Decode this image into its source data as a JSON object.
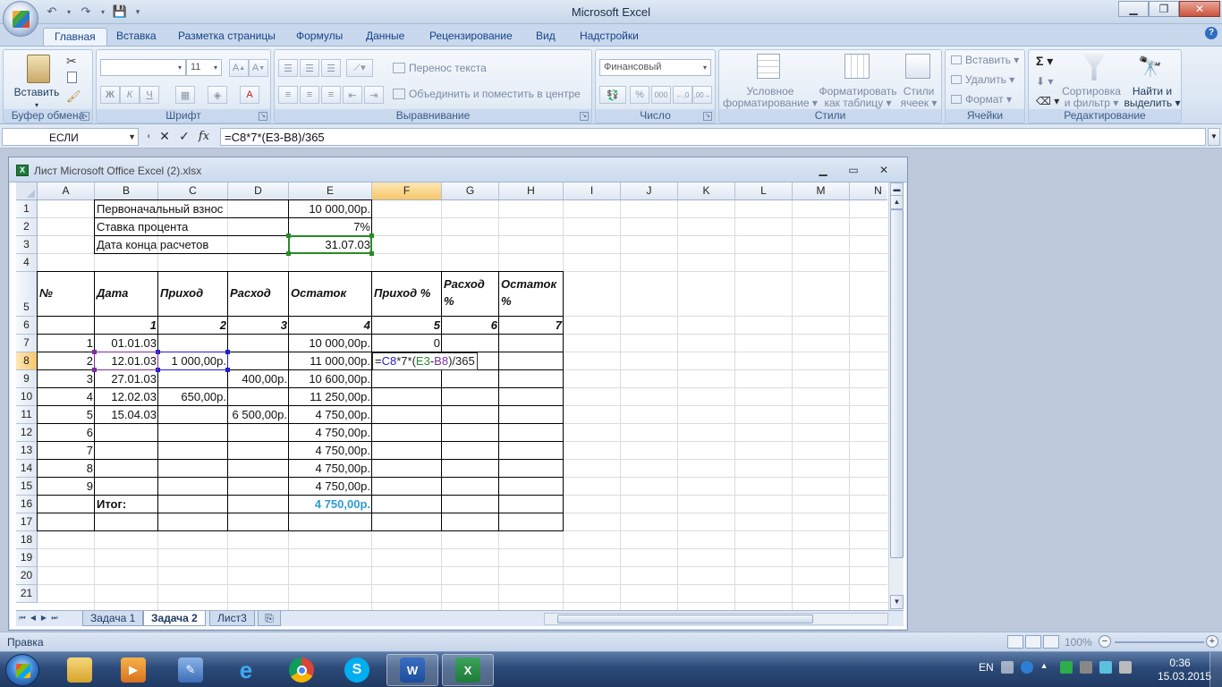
{
  "app": {
    "title": "Microsoft Excel"
  },
  "ribbon_tabs": [
    "Главная",
    "Вставка",
    "Разметка страницы",
    "Формулы",
    "Данные",
    "Рецензирование",
    "Вид",
    "Надстройки"
  ],
  "ribbon": {
    "clipboard": {
      "label": "Буфер обмена",
      "paste": "Вставить"
    },
    "font": {
      "label": "Шрифт",
      "size": "11",
      "bold": "Ж",
      "italic": "К",
      "underline": "Ч"
    },
    "alignment": {
      "label": "Выравнивание",
      "wrap": "Перенос текста",
      "merge": "Объединить и поместить в центре"
    },
    "number": {
      "label": "Число",
      "format": "Финансовый",
      "percent": "%",
      "thousands": "000"
    },
    "styles": {
      "label": "Стили",
      "conditional_1": "Условное",
      "conditional_2": "форматирование",
      "table_1": "Форматировать",
      "table_2": "как таблицу",
      "cell_1": "Стили",
      "cell_2": "ячеек"
    },
    "cells": {
      "label": "Ячейки",
      "insert": "Вставить",
      "delete": "Удалить",
      "format": "Формат"
    },
    "editing": {
      "label": "Редактирование",
      "sort_1": "Сортировка",
      "sort_2": "и фильтр",
      "find_1": "Найти и",
      "find_2": "выделить"
    }
  },
  "formula_bar": {
    "name_box": "ЕСЛИ",
    "formula": "=C8*7*(E3-B8)/365",
    "fx": "fx"
  },
  "workbook": {
    "title": "Лист Microsoft Office Excel (2).xlsx"
  },
  "columns": [
    "A",
    "B",
    "C",
    "D",
    "E",
    "F",
    "G",
    "H",
    "I",
    "J",
    "K",
    "L",
    "M",
    "N"
  ],
  "rows": [
    "1",
    "2",
    "3",
    "4",
    "5",
    "6",
    "7",
    "8",
    "9",
    "10",
    "11",
    "12",
    "13",
    "14",
    "15",
    "16",
    "17",
    "18",
    "19",
    "20",
    "21"
  ],
  "cells": {
    "B1": "Первоначальный взнос",
    "E1": "10 000,00р.",
    "B2": "Ставка процента",
    "E2": "7%",
    "B3": "Дата конца расчетов",
    "E3": "31.07.03",
    "A5": "№",
    "B5": "Дата",
    "C5": "Приход",
    "D5": "Расход",
    "E5": "Остаток",
    "F5": "Приход %",
    "G5": "Расход %",
    "H5": "Остаток %",
    "B6": "1",
    "C6": "2",
    "D6": "3",
    "E6": "4",
    "F6": "5",
    "G6": "6",
    "H6": "7",
    "A7": "1",
    "B7": "01.01.03",
    "E7": "10 000,00р.",
    "F7": "0",
    "A8": "2",
    "B8": "12.01.03",
    "C8": "1 000,00р.",
    "E8": "11 000,00р.",
    "A9": "3",
    "B9": "27.01.03",
    "D9": "400,00р.",
    "E9": "10 600,00р.",
    "A10": "4",
    "B10": "12.02.03",
    "C10": "650,00р.",
    "E10": "11 250,00р.",
    "A11": "5",
    "B11": "15.04.03",
    "D11": "6 500,00р.",
    "E11": "4 750,00р.",
    "A12": "6",
    "E12": "4 750,00р.",
    "A13": "7",
    "E13": "4 750,00р.",
    "A14": "8",
    "E14": "4 750,00р.",
    "A15": "9",
    "E15": "4 750,00р.",
    "B16": "Итог:",
    "E16": "4 750,00р."
  },
  "editing_cell": {
    "ref": "F8",
    "prefix": "=",
    "ref1": "C8",
    "mid": "*7*(",
    "ref2": "E3",
    "dash": "-",
    "ref3": "B8",
    "suffix": ")/365"
  },
  "sheet_tabs": [
    "Задача 1",
    "Задача 2",
    "Лист3"
  ],
  "status": {
    "mode": "Правка",
    "zoom": "100%"
  },
  "taskbar": {
    "lang": "EN",
    "time": "0:36",
    "date": "15.03.2015"
  },
  "colors": {
    "accent_blue": "#2e9bd6",
    "ref_green": "#2a8a2a",
    "ref_purple": "#7a2fa0",
    "ref_blue": "#2222cc"
  }
}
